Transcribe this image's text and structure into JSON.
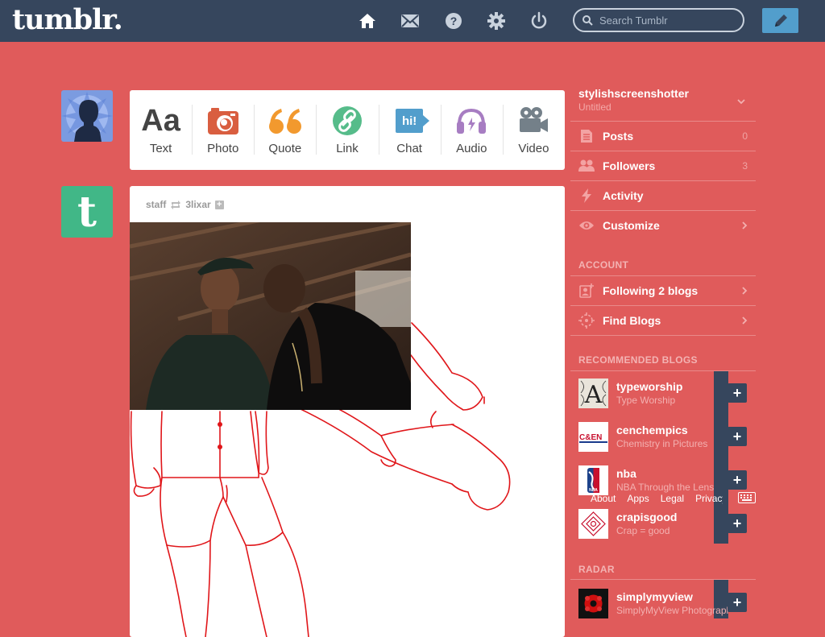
{
  "header": {
    "logo": "tumblr.",
    "search_placeholder": "Search Tumblr"
  },
  "post_types": [
    {
      "label": "Text",
      "icon": "text-icon",
      "color": "#444444"
    },
    {
      "label": "Photo",
      "icon": "camera-icon",
      "color": "#d95e40"
    },
    {
      "label": "Quote",
      "icon": "quote-icon",
      "color": "#f2992e"
    },
    {
      "label": "Link",
      "icon": "link-icon",
      "color": "#56bc8a"
    },
    {
      "label": "Chat",
      "icon": "chat-icon",
      "color": "#529ecc",
      "icon_text": "hi!"
    },
    {
      "label": "Audio",
      "icon": "headphones-icon",
      "color": "#a77dc2"
    },
    {
      "label": "Video",
      "icon": "video-camera-icon",
      "color": "#748089"
    }
  ],
  "post": {
    "author": "staff",
    "reblogged_from": "3lixar"
  },
  "sidebar": {
    "blog_name": "stylishscreenshotter",
    "blog_title": "Untitled",
    "items": [
      {
        "label": "Posts",
        "count": "0"
      },
      {
        "label": "Followers",
        "count": "3"
      },
      {
        "label": "Activity",
        "count": ""
      },
      {
        "label": "Customize",
        "count": ""
      }
    ],
    "account_heading": "ACCOUNT",
    "account_items": [
      {
        "label": "Following 2 blogs"
      },
      {
        "label": "Find Blogs"
      }
    ],
    "recommended_heading": "RECOMMENDED BLOGS",
    "recommended": [
      {
        "name": "typeworship",
        "desc": "Type Worship"
      },
      {
        "name": "cenchempics",
        "desc": "Chemistry in Pictures"
      },
      {
        "name": "nba",
        "desc": "NBA Through the Lens"
      },
      {
        "name": "crapisgood",
        "desc": "Crap = good"
      }
    ],
    "footer_links": [
      "About",
      "Apps",
      "Legal",
      "Privacy"
    ],
    "radar_heading": "RADAR",
    "radar": {
      "name": "simplymyview",
      "desc": "SimplyMyView Photography"
    }
  },
  "colors": {
    "background": "#e05b5b",
    "header": "#36465d",
    "compose": "#529ecc",
    "drawing_stroke": "#e0161a"
  }
}
